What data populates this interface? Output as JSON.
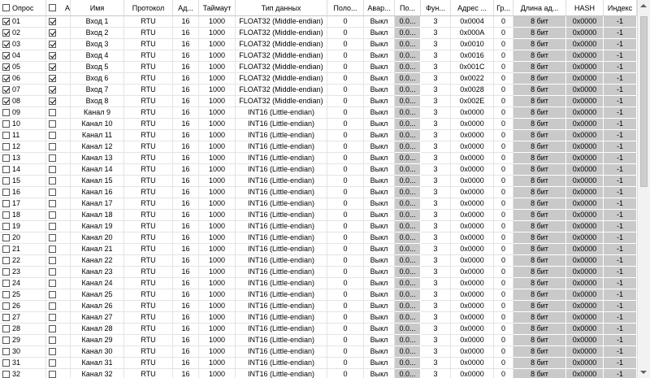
{
  "columns": [
    "Опрос",
    "А",
    "Имя",
    "Протокол",
    "Ад...",
    "Таймаут",
    "Тип данных",
    "Поло...",
    "Авар...",
    "По...",
    "Фун...",
    "Адрес ...",
    "Гр...",
    "Длина ад...",
    "HASH",
    "Индекс"
  ],
  "rows": [
    {
      "checked": true,
      "flag": true,
      "num": "01",
      "name": "Вход 1",
      "protocol": "RTU",
      "addr": "16",
      "timeout": "1000",
      "type": "FLOAT32 (Middle-endian)",
      "pos": "0",
      "alarm": "Выкл",
      "po": "0.0...",
      "func": "3",
      "address": "0x0004",
      "group": "0",
      "length": "8 бит",
      "hash": "0x0000",
      "index": "-1"
    },
    {
      "checked": true,
      "flag": true,
      "num": "02",
      "name": "Вход 2",
      "protocol": "RTU",
      "addr": "16",
      "timeout": "1000",
      "type": "FLOAT32 (Middle-endian)",
      "pos": "0",
      "alarm": "Выкл",
      "po": "0.0...",
      "func": "3",
      "address": "0x000A",
      "group": "0",
      "length": "8 бит",
      "hash": "0x0000",
      "index": "-1"
    },
    {
      "checked": true,
      "flag": true,
      "num": "03",
      "name": "Вход 3",
      "protocol": "RTU",
      "addr": "16",
      "timeout": "1000",
      "type": "FLOAT32 (Middle-endian)",
      "pos": "0",
      "alarm": "Выкл",
      "po": "0.0...",
      "func": "3",
      "address": "0x0010",
      "group": "0",
      "length": "8 бит",
      "hash": "0x0000",
      "index": "-1"
    },
    {
      "checked": true,
      "flag": true,
      "num": "04",
      "name": "Вход 4",
      "protocol": "RTU",
      "addr": "16",
      "timeout": "1000",
      "type": "FLOAT32 (Middle-endian)",
      "pos": "0",
      "alarm": "Выкл",
      "po": "0.0...",
      "func": "3",
      "address": "0x0016",
      "group": "0",
      "length": "8 бит",
      "hash": "0x0000",
      "index": "-1"
    },
    {
      "checked": true,
      "flag": true,
      "num": "05",
      "name": "Вход 5",
      "protocol": "RTU",
      "addr": "16",
      "timeout": "1000",
      "type": "FLOAT32 (Middle-endian)",
      "pos": "0",
      "alarm": "Выкл",
      "po": "0.0...",
      "func": "3",
      "address": "0x001C",
      "group": "0",
      "length": "8 бит",
      "hash": "0x0000",
      "index": "-1"
    },
    {
      "checked": true,
      "flag": true,
      "num": "06",
      "name": "Вход 6",
      "protocol": "RTU",
      "addr": "16",
      "timeout": "1000",
      "type": "FLOAT32 (Middle-endian)",
      "pos": "0",
      "alarm": "Выкл",
      "po": "0.0...",
      "func": "3",
      "address": "0x0022",
      "group": "0",
      "length": "8 бит",
      "hash": "0x0000",
      "index": "-1"
    },
    {
      "checked": true,
      "flag": true,
      "num": "07",
      "name": "Вход 7",
      "protocol": "RTU",
      "addr": "16",
      "timeout": "1000",
      "type": "FLOAT32 (Middle-endian)",
      "pos": "0",
      "alarm": "Выкл",
      "po": "0.0...",
      "func": "3",
      "address": "0x0028",
      "group": "0",
      "length": "8 бит",
      "hash": "0x0000",
      "index": "-1"
    },
    {
      "checked": true,
      "flag": true,
      "num": "08",
      "name": "Вход 8",
      "protocol": "RTU",
      "addr": "16",
      "timeout": "1000",
      "type": "FLOAT32 (Middle-endian)",
      "pos": "0",
      "alarm": "Выкл",
      "po": "0.0...",
      "func": "3",
      "address": "0x002E",
      "group": "0",
      "length": "8 бит",
      "hash": "0x0000",
      "index": "-1"
    },
    {
      "checked": false,
      "flag": false,
      "num": "09",
      "name": "Канал 9",
      "protocol": "RTU",
      "addr": "16",
      "timeout": "1000",
      "type": "INT16 (Little-endian)",
      "pos": "0",
      "alarm": "Выкл",
      "po": "0.0...",
      "func": "3",
      "address": "0x0000",
      "group": "0",
      "length": "8 бит",
      "hash": "0x0000",
      "index": "-1"
    },
    {
      "checked": false,
      "flag": false,
      "num": "10",
      "name": "Канал 10",
      "protocol": "RTU",
      "addr": "16",
      "timeout": "1000",
      "type": "INT16 (Little-endian)",
      "pos": "0",
      "alarm": "Выкл",
      "po": "0.0...",
      "func": "3",
      "address": "0x0000",
      "group": "0",
      "length": "8 бит",
      "hash": "0x0000",
      "index": "-1"
    },
    {
      "checked": false,
      "flag": false,
      "num": "11",
      "name": "Канал 11",
      "protocol": "RTU",
      "addr": "16",
      "timeout": "1000",
      "type": "INT16 (Little-endian)",
      "pos": "0",
      "alarm": "Выкл",
      "po": "0.0...",
      "func": "3",
      "address": "0x0000",
      "group": "0",
      "length": "8 бит",
      "hash": "0x0000",
      "index": "-1"
    },
    {
      "checked": false,
      "flag": false,
      "num": "12",
      "name": "Канал 12",
      "protocol": "RTU",
      "addr": "16",
      "timeout": "1000",
      "type": "INT16 (Little-endian)",
      "pos": "0",
      "alarm": "Выкл",
      "po": "0.0...",
      "func": "3",
      "address": "0x0000",
      "group": "0",
      "length": "8 бит",
      "hash": "0x0000",
      "index": "-1"
    },
    {
      "checked": false,
      "flag": false,
      "num": "13",
      "name": "Канал 13",
      "protocol": "RTU",
      "addr": "16",
      "timeout": "1000",
      "type": "INT16 (Little-endian)",
      "pos": "0",
      "alarm": "Выкл",
      "po": "0.0...",
      "func": "3",
      "address": "0x0000",
      "group": "0",
      "length": "8 бит",
      "hash": "0x0000",
      "index": "-1"
    },
    {
      "checked": false,
      "flag": false,
      "num": "14",
      "name": "Канал 14",
      "protocol": "RTU",
      "addr": "16",
      "timeout": "1000",
      "type": "INT16 (Little-endian)",
      "pos": "0",
      "alarm": "Выкл",
      "po": "0.0...",
      "func": "3",
      "address": "0x0000",
      "group": "0",
      "length": "8 бит",
      "hash": "0x0000",
      "index": "-1"
    },
    {
      "checked": false,
      "flag": false,
      "num": "15",
      "name": "Канал 15",
      "protocol": "RTU",
      "addr": "16",
      "timeout": "1000",
      "type": "INT16 (Little-endian)",
      "pos": "0",
      "alarm": "Выкл",
      "po": "0.0...",
      "func": "3",
      "address": "0x0000",
      "group": "0",
      "length": "8 бит",
      "hash": "0x0000",
      "index": "-1"
    },
    {
      "checked": false,
      "flag": false,
      "num": "16",
      "name": "Канал 16",
      "protocol": "RTU",
      "addr": "16",
      "timeout": "1000",
      "type": "INT16 (Little-endian)",
      "pos": "0",
      "alarm": "Выкл",
      "po": "0.0...",
      "func": "3",
      "address": "0x0000",
      "group": "0",
      "length": "8 бит",
      "hash": "0x0000",
      "index": "-1"
    },
    {
      "checked": false,
      "flag": false,
      "num": "17",
      "name": "Канал 17",
      "protocol": "RTU",
      "addr": "16",
      "timeout": "1000",
      "type": "INT16 (Little-endian)",
      "pos": "0",
      "alarm": "Выкл",
      "po": "0.0...",
      "func": "3",
      "address": "0x0000",
      "group": "0",
      "length": "8 бит",
      "hash": "0x0000",
      "index": "-1"
    },
    {
      "checked": false,
      "flag": false,
      "num": "18",
      "name": "Канал 18",
      "protocol": "RTU",
      "addr": "16",
      "timeout": "1000",
      "type": "INT16 (Little-endian)",
      "pos": "0",
      "alarm": "Выкл",
      "po": "0.0...",
      "func": "3",
      "address": "0x0000",
      "group": "0",
      "length": "8 бит",
      "hash": "0x0000",
      "index": "-1"
    },
    {
      "checked": false,
      "flag": false,
      "num": "19",
      "name": "Канал 19",
      "protocol": "RTU",
      "addr": "16",
      "timeout": "1000",
      "type": "INT16 (Little-endian)",
      "pos": "0",
      "alarm": "Выкл",
      "po": "0.0...",
      "func": "3",
      "address": "0x0000",
      "group": "0",
      "length": "8 бит",
      "hash": "0x0000",
      "index": "-1"
    },
    {
      "checked": false,
      "flag": false,
      "num": "20",
      "name": "Канал 20",
      "protocol": "RTU",
      "addr": "16",
      "timeout": "1000",
      "type": "INT16 (Little-endian)",
      "pos": "0",
      "alarm": "Выкл",
      "po": "0.0...",
      "func": "3",
      "address": "0x0000",
      "group": "0",
      "length": "8 бит",
      "hash": "0x0000",
      "index": "-1"
    },
    {
      "checked": false,
      "flag": false,
      "num": "21",
      "name": "Канал 21",
      "protocol": "RTU",
      "addr": "16",
      "timeout": "1000",
      "type": "INT16 (Little-endian)",
      "pos": "0",
      "alarm": "Выкл",
      "po": "0.0...",
      "func": "3",
      "address": "0x0000",
      "group": "0",
      "length": "8 бит",
      "hash": "0x0000",
      "index": "-1"
    },
    {
      "checked": false,
      "flag": false,
      "num": "22",
      "name": "Канал 22",
      "protocol": "RTU",
      "addr": "16",
      "timeout": "1000",
      "type": "INT16 (Little-endian)",
      "pos": "0",
      "alarm": "Выкл",
      "po": "0.0...",
      "func": "3",
      "address": "0x0000",
      "group": "0",
      "length": "8 бит",
      "hash": "0x0000",
      "index": "-1"
    },
    {
      "checked": false,
      "flag": false,
      "num": "23",
      "name": "Канал 23",
      "protocol": "RTU",
      "addr": "16",
      "timeout": "1000",
      "type": "INT16 (Little-endian)",
      "pos": "0",
      "alarm": "Выкл",
      "po": "0.0...",
      "func": "3",
      "address": "0x0000",
      "group": "0",
      "length": "8 бит",
      "hash": "0x0000",
      "index": "-1"
    },
    {
      "checked": false,
      "flag": false,
      "num": "24",
      "name": "Канал 24",
      "protocol": "RTU",
      "addr": "16",
      "timeout": "1000",
      "type": "INT16 (Little-endian)",
      "pos": "0",
      "alarm": "Выкл",
      "po": "0.0...",
      "func": "3",
      "address": "0x0000",
      "group": "0",
      "length": "8 бит",
      "hash": "0x0000",
      "index": "-1"
    },
    {
      "checked": false,
      "flag": false,
      "num": "25",
      "name": "Канал 25",
      "protocol": "RTU",
      "addr": "16",
      "timeout": "1000",
      "type": "INT16 (Little-endian)",
      "pos": "0",
      "alarm": "Выкл",
      "po": "0.0...",
      "func": "3",
      "address": "0x0000",
      "group": "0",
      "length": "8 бит",
      "hash": "0x0000",
      "index": "-1"
    },
    {
      "checked": false,
      "flag": false,
      "num": "26",
      "name": "Канал 26",
      "protocol": "RTU",
      "addr": "16",
      "timeout": "1000",
      "type": "INT16 (Little-endian)",
      "pos": "0",
      "alarm": "Выкл",
      "po": "0.0...",
      "func": "3",
      "address": "0x0000",
      "group": "0",
      "length": "8 бит",
      "hash": "0x0000",
      "index": "-1"
    },
    {
      "checked": false,
      "flag": false,
      "num": "27",
      "name": "Канал 27",
      "protocol": "RTU",
      "addr": "16",
      "timeout": "1000",
      "type": "INT16 (Little-endian)",
      "pos": "0",
      "alarm": "Выкл",
      "po": "0.0...",
      "func": "3",
      "address": "0x0000",
      "group": "0",
      "length": "8 бит",
      "hash": "0x0000",
      "index": "-1"
    },
    {
      "checked": false,
      "flag": false,
      "num": "28",
      "name": "Канал 28",
      "protocol": "RTU",
      "addr": "16",
      "timeout": "1000",
      "type": "INT16 (Little-endian)",
      "pos": "0",
      "alarm": "Выкл",
      "po": "0.0...",
      "func": "3",
      "address": "0x0000",
      "group": "0",
      "length": "8 бит",
      "hash": "0x0000",
      "index": "-1"
    },
    {
      "checked": false,
      "flag": false,
      "num": "29",
      "name": "Канал 29",
      "protocol": "RTU",
      "addr": "16",
      "timeout": "1000",
      "type": "INT16 (Little-endian)",
      "pos": "0",
      "alarm": "Выкл",
      "po": "0.0...",
      "func": "3",
      "address": "0x0000",
      "group": "0",
      "length": "8 бит",
      "hash": "0x0000",
      "index": "-1"
    },
    {
      "checked": false,
      "flag": false,
      "num": "30",
      "name": "Канал 30",
      "protocol": "RTU",
      "addr": "16",
      "timeout": "1000",
      "type": "INT16 (Little-endian)",
      "pos": "0",
      "alarm": "Выкл",
      "po": "0.0...",
      "func": "3",
      "address": "0x0000",
      "group": "0",
      "length": "8 бит",
      "hash": "0x0000",
      "index": "-1"
    },
    {
      "checked": false,
      "flag": false,
      "num": "31",
      "name": "Канал 31",
      "protocol": "RTU",
      "addr": "16",
      "timeout": "1000",
      "type": "INT16 (Little-endian)",
      "pos": "0",
      "alarm": "Выкл",
      "po": "0.0...",
      "func": "3",
      "address": "0x0000",
      "group": "0",
      "length": "8 бит",
      "hash": "0x0000",
      "index": "-1"
    },
    {
      "checked": false,
      "flag": false,
      "num": "32",
      "name": "Канал 32",
      "protocol": "RTU",
      "addr": "16",
      "timeout": "1000",
      "type": "INT16 (Little-endian)",
      "pos": "0",
      "alarm": "Выкл",
      "po": "0.0...",
      "func": "3",
      "address": "0x0000",
      "group": "0",
      "length": "8 бит",
      "hash": "0x0000",
      "index": "-1"
    }
  ],
  "scrollbar": {
    "up_icon": "scroll-up-arrow",
    "down_icon": "scroll-down-arrow"
  }
}
